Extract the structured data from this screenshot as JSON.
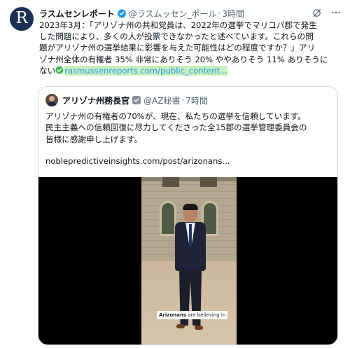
{
  "tweet": {
    "avatar_letter": "R",
    "author_name": "ラスムセンレポート",
    "handle": "@ラスムッセン_ポール",
    "separator": "·",
    "time": "3時間",
    "text_lines": [
      "2023年3月：「アリゾナ州の共和党員は、2022年の選挙でマリコパ郡で発生",
      "した問題により、多くの人が投票できなかったと述べています。これらの問",
      "題がアリゾナ州の選挙結果に影響を与えた可能性はどの程度ですか？」アリ",
      "ゾナ州全体の有権者 35% 非常にありそう 20% ややありそう 11% ありそうに"
    ],
    "text_tail": "ない",
    "link": "rasmussenreports.com/public_content..."
  },
  "quote": {
    "author_name": "アリゾナ州務長官",
    "handle": "@AZ秘書",
    "separator": "·",
    "time": "7時間",
    "text_lines": [
      "アリゾナ州の有権者の70%が、現在、私たちの選挙を信頼しています。",
      "民主主義への信頼回復に尽力してくださった全15郡の選挙管理委員会の",
      "皆様に感謝申し上げます。"
    ],
    "url": "noblepredictiveinsights.com/post/arizonans...",
    "video_caption_bold": "Arizonans",
    "video_caption_rest": " are believing in"
  },
  "colors": {
    "accent": "#1d9bf0",
    "link_highlight": "#c9f0bd",
    "gold_badge": "#e2b719",
    "muted": "#536471"
  },
  "icons": [
    "verified-badge-icon",
    "grok-icon",
    "more-options-icon",
    "checkmark-icon",
    "government-badge-icon"
  ]
}
